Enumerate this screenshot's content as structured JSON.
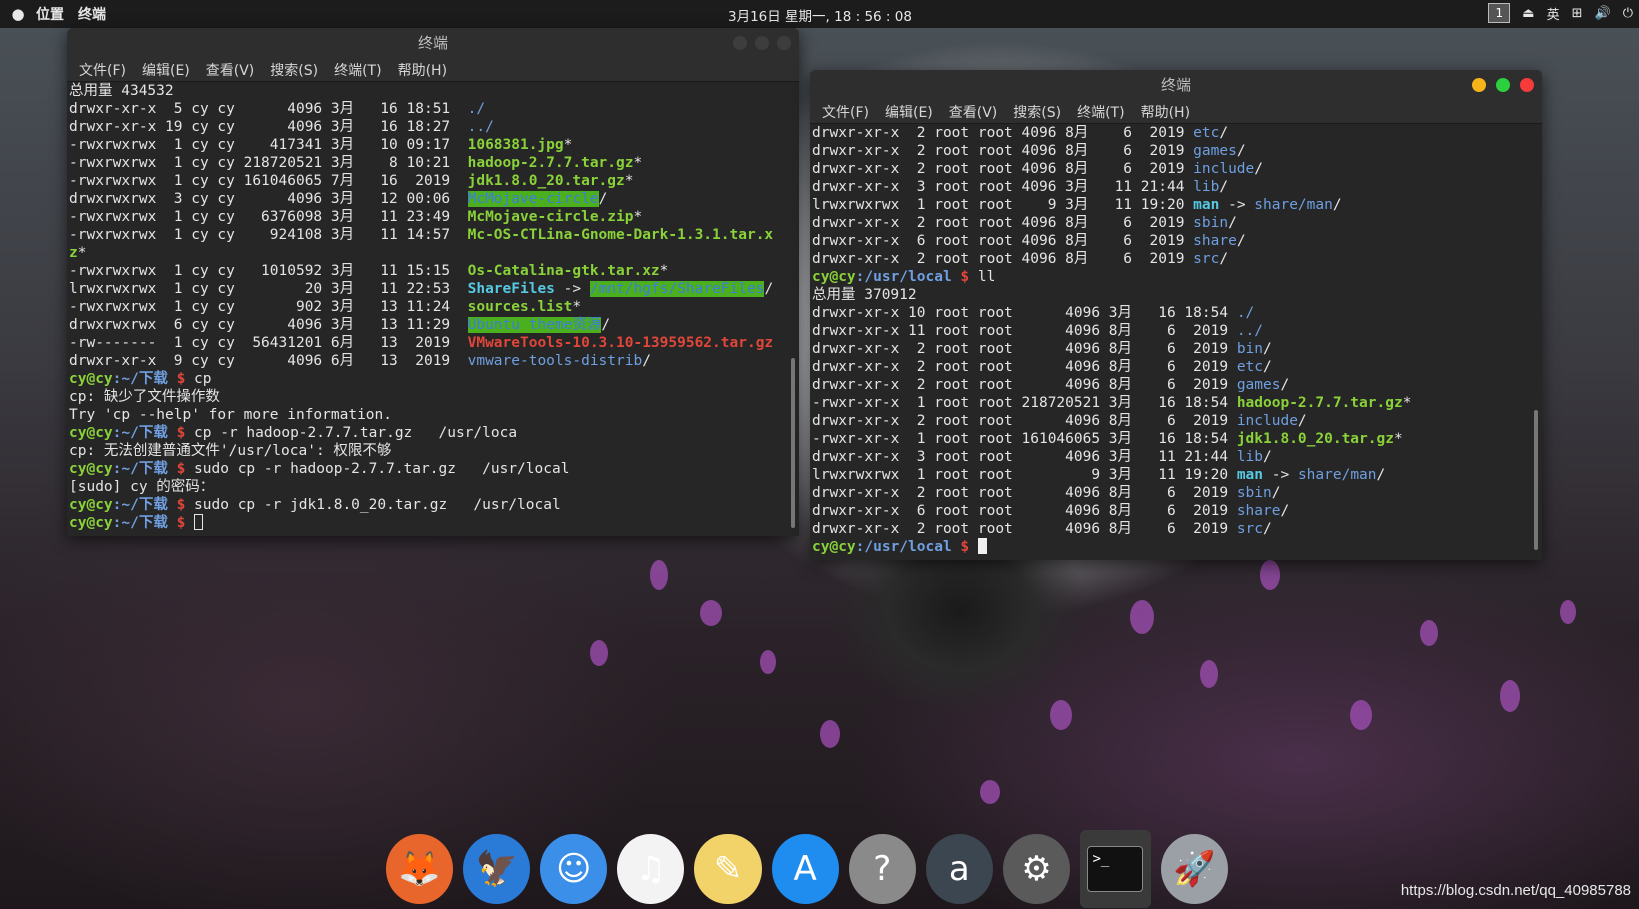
{
  "top_panel": {
    "menu": [
      "位置",
      "终端"
    ],
    "clock": "3月16日 星期一, 18 : 56 : 08",
    "workspace": "1",
    "input_method": "英"
  },
  "term_left": {
    "title": "终端",
    "menu": [
      "文件(F)",
      "编辑(E)",
      "查看(V)",
      "搜索(S)",
      "终端(T)",
      "帮助(H)"
    ],
    "lines": [
      [
        {
          "t": "总用量 434532"
        }
      ],
      [
        {
          "t": "drwxr-xr-x  5 cy cy      4096 3月   16 18:51  "
        },
        {
          "t": "./",
          "c": "c-blue"
        }
      ],
      [
        {
          "t": "drwxr-xr-x 19 cy cy      4096 3月   16 18:27  "
        },
        {
          "t": "../",
          "c": "c-blue"
        }
      ],
      [
        {
          "t": "-rwxrwxrwx  1 cy cy    417341 3月   10 09:17  "
        },
        {
          "t": "1068381.jpg",
          "c": "c-green"
        },
        {
          "t": "*"
        }
      ],
      [
        {
          "t": "-rwxrwxrwx  1 cy cy 218720521 3月    8 10:21  "
        },
        {
          "t": "hadoop-2.7.7.tar.gz",
          "c": "c-green"
        },
        {
          "t": "*"
        }
      ],
      [
        {
          "t": "-rwxrwxrwx  1 cy cy 161046065 7月   16  2019  "
        },
        {
          "t": "jdk1.8.0_20.tar.gz",
          "c": "c-green"
        },
        {
          "t": "*"
        }
      ],
      [
        {
          "t": "drwxrwxrwx  3 cy cy      4096 3月   12 00:06  "
        },
        {
          "t": "McMojave-circle",
          "c": "hl-dir"
        },
        {
          "t": "/"
        }
      ],
      [
        {
          "t": "-rwxrwxrwx  1 cy cy   6376098 3月   11 23:49  "
        },
        {
          "t": "McMojave-circle.zip",
          "c": "c-green"
        },
        {
          "t": "*"
        }
      ],
      [
        {
          "t": "-rwxrwxrwx  1 cy cy    924108 3月   11 14:57  "
        },
        {
          "t": "Mc-OS-CTLina-Gnome-Dark-1.3.1.tar.x",
          "c": "c-green"
        }
      ],
      [
        {
          "t": "z",
          "c": "c-green"
        },
        {
          "t": "*"
        }
      ],
      [
        {
          "t": "-rwxrwxrwx  1 cy cy   1010592 3月   11 15:15  "
        },
        {
          "t": "Os-Catalina-gtk.tar.xz",
          "c": "c-green"
        },
        {
          "t": "*"
        }
      ],
      [
        {
          "t": "lrwxrwxrwx  1 cy cy        20 3月   11 22:53  "
        },
        {
          "t": "ShareFiles",
          "c": "c-cyan"
        },
        {
          "t": " -> "
        },
        {
          "t": "/mnt/hgfs/ShareFiles",
          "c": "hl-dir"
        },
        {
          "t": "/"
        }
      ],
      [
        {
          "t": "-rwxrwxrwx  1 cy cy       902 3月   13 11:24  "
        },
        {
          "t": "sources.list",
          "c": "c-green"
        },
        {
          "t": "*"
        }
      ],
      [
        {
          "t": "drwxrwxrwx  6 cy cy      4096 3月   13 11:29  "
        },
        {
          "t": "Ubuntu theme资源",
          "c": "hl-dir"
        },
        {
          "t": "/"
        }
      ],
      [
        {
          "t": "-rw-------  1 cy cy  56431201 6月   13  2019  "
        },
        {
          "t": "VMwareTools-10.3.10-13959562.tar.gz",
          "c": "c-red"
        }
      ],
      [
        {
          "t": "drwxr-xr-x  9 cy cy      4096 6月   13  2019  "
        },
        {
          "t": "vmware-tools-distrib",
          "c": "c-blue"
        },
        {
          "t": "/"
        }
      ],
      [
        {
          "t": "cy@cy",
          "c": "c-prompt-user"
        },
        {
          "t": ":~/下载 ",
          "c": "c-prompt-path"
        },
        {
          "t": "$ ",
          "c": "c-prompt-sign"
        },
        {
          "t": "cp"
        }
      ],
      [
        {
          "t": "cp: 缺少了文件操作数"
        }
      ],
      [
        {
          "t": "Try 'cp --help' for more information."
        }
      ],
      [
        {
          "t": "cy@cy",
          "c": "c-prompt-user"
        },
        {
          "t": ":~/下载 ",
          "c": "c-prompt-path"
        },
        {
          "t": "$ ",
          "c": "c-prompt-sign"
        },
        {
          "t": "cp -r hadoop-2.7.7.tar.gz   /usr/loca"
        }
      ],
      [
        {
          "t": "cp: 无法创建普通文件'/usr/loca': 权限不够"
        }
      ],
      [
        {
          "t": "cy@cy",
          "c": "c-prompt-user"
        },
        {
          "t": ":~/下载 ",
          "c": "c-prompt-path"
        },
        {
          "t": "$ ",
          "c": "c-prompt-sign"
        },
        {
          "t": "sudo cp -r hadoop-2.7.7.tar.gz   /usr/local"
        }
      ],
      [
        {
          "t": "[sudo] cy 的密码："
        }
      ],
      [
        {
          "t": "cy@cy",
          "c": "c-prompt-user"
        },
        {
          "t": ":~/下载 ",
          "c": "c-prompt-path"
        },
        {
          "t": "$ ",
          "c": "c-prompt-sign"
        },
        {
          "t": "sudo cp -r jdk1.8.0_20.tar.gz   /usr/local"
        }
      ],
      [
        {
          "t": "cy@cy",
          "c": "c-prompt-user"
        },
        {
          "t": ":~/下载 ",
          "c": "c-prompt-path"
        },
        {
          "t": "$ ",
          "c": "c-prompt-sign"
        },
        {
          "cursor": "hollow"
        }
      ]
    ]
  },
  "term_right": {
    "title": "终端",
    "menu": [
      "文件(F)",
      "编辑(E)",
      "查看(V)",
      "搜索(S)",
      "终端(T)",
      "帮助(H)"
    ],
    "lines": [
      [
        {
          "t": "drwxr-xr-x  2 root root 4096 8月    6  2019 "
        },
        {
          "t": "etc",
          "c": "c-blue"
        },
        {
          "t": "/"
        }
      ],
      [
        {
          "t": "drwxr-xr-x  2 root root 4096 8月    6  2019 "
        },
        {
          "t": "games",
          "c": "c-blue"
        },
        {
          "t": "/"
        }
      ],
      [
        {
          "t": "drwxr-xr-x  2 root root 4096 8月    6  2019 "
        },
        {
          "t": "include",
          "c": "c-blue"
        },
        {
          "t": "/"
        }
      ],
      [
        {
          "t": "drwxr-xr-x  3 root root 4096 3月   11 21:44 "
        },
        {
          "t": "lib",
          "c": "c-blue"
        },
        {
          "t": "/"
        }
      ],
      [
        {
          "t": "lrwxrwxrwx  1 root root    9 3月   11 19:20 "
        },
        {
          "t": "man",
          "c": "c-cyan"
        },
        {
          "t": " -> "
        },
        {
          "t": "share/man",
          "c": "c-blue"
        },
        {
          "t": "/"
        }
      ],
      [
        {
          "t": "drwxr-xr-x  2 root root 4096 8月    6  2019 "
        },
        {
          "t": "sbin",
          "c": "c-blue"
        },
        {
          "t": "/"
        }
      ],
      [
        {
          "t": "drwxr-xr-x  6 root root 4096 8月    6  2019 "
        },
        {
          "t": "share",
          "c": "c-blue"
        },
        {
          "t": "/"
        }
      ],
      [
        {
          "t": "drwxr-xr-x  2 root root 4096 8月    6  2019 "
        },
        {
          "t": "src",
          "c": "c-blue"
        },
        {
          "t": "/"
        }
      ],
      [
        {
          "t": "cy@cy",
          "c": "c-prompt-user"
        },
        {
          "t": ":/usr/local ",
          "c": "c-prompt-path"
        },
        {
          "t": "$ ",
          "c": "c-prompt-sign"
        },
        {
          "t": "ll"
        }
      ],
      [
        {
          "t": "总用量 370912"
        }
      ],
      [
        {
          "t": "drwxr-xr-x 10 root root      4096 3月   16 18:54 "
        },
        {
          "t": "./",
          "c": "c-blue"
        }
      ],
      [
        {
          "t": "drwxr-xr-x 11 root root      4096 8月    6  2019 "
        },
        {
          "t": "../",
          "c": "c-blue"
        }
      ],
      [
        {
          "t": "drwxr-xr-x  2 root root      4096 8月    6  2019 "
        },
        {
          "t": "bin",
          "c": "c-blue"
        },
        {
          "t": "/"
        }
      ],
      [
        {
          "t": "drwxr-xr-x  2 root root      4096 8月    6  2019 "
        },
        {
          "t": "etc",
          "c": "c-blue"
        },
        {
          "t": "/"
        }
      ],
      [
        {
          "t": "drwxr-xr-x  2 root root      4096 8月    6  2019 "
        },
        {
          "t": "games",
          "c": "c-blue"
        },
        {
          "t": "/"
        }
      ],
      [
        {
          "t": "-rwxr-xr-x  1 root root 218720521 3月   16 18:54 "
        },
        {
          "t": "hadoop-2.7.7.tar.gz",
          "c": "c-green"
        },
        {
          "t": "*"
        }
      ],
      [
        {
          "t": "drwxr-xr-x  2 root root      4096 8月    6  2019 "
        },
        {
          "t": "include",
          "c": "c-blue"
        },
        {
          "t": "/"
        }
      ],
      [
        {
          "t": "-rwxr-xr-x  1 root root 161046065 3月   16 18:54 "
        },
        {
          "t": "jdk1.8.0_20.tar.gz",
          "c": "c-green"
        },
        {
          "t": "*"
        }
      ],
      [
        {
          "t": "drwxr-xr-x  3 root root      4096 3月   11 21:44 "
        },
        {
          "t": "lib",
          "c": "c-blue"
        },
        {
          "t": "/"
        }
      ],
      [
        {
          "t": "lrwxrwxrwx  1 root root         9 3月   11 19:20 "
        },
        {
          "t": "man",
          "c": "c-cyan"
        },
        {
          "t": " -> "
        },
        {
          "t": "share/man",
          "c": "c-blue"
        },
        {
          "t": "/"
        }
      ],
      [
        {
          "t": "drwxr-xr-x  2 root root      4096 8月    6  2019 "
        },
        {
          "t": "sbin",
          "c": "c-blue"
        },
        {
          "t": "/"
        }
      ],
      [
        {
          "t": "drwxr-xr-x  6 root root      4096 8月    6  2019 "
        },
        {
          "t": "share",
          "c": "c-blue"
        },
        {
          "t": "/"
        }
      ],
      [
        {
          "t": "drwxr-xr-x  2 root root      4096 8月    6  2019 "
        },
        {
          "t": "src",
          "c": "c-blue"
        },
        {
          "t": "/"
        }
      ],
      [
        {
          "t": "cy@cy",
          "c": "c-prompt-user"
        },
        {
          "t": ":/usr/local ",
          "c": "c-prompt-path"
        },
        {
          "t": "$ ",
          "c": "c-prompt-sign"
        },
        {
          "cursor": "solid"
        }
      ]
    ]
  },
  "dock": [
    {
      "name": "firefox-icon",
      "glyph": "🦊",
      "color": "#e8662c"
    },
    {
      "name": "thunderbird-icon",
      "glyph": "🦅",
      "color": "#2a7ad8"
    },
    {
      "name": "finder-icon",
      "glyph": "☺",
      "color": "#3b8fe8"
    },
    {
      "name": "music-icon",
      "glyph": "♫",
      "color": "#f3f3f3"
    },
    {
      "name": "text-editor-icon",
      "glyph": "✎",
      "color": "#f2d36a"
    },
    {
      "name": "app-store-icon",
      "glyph": "A",
      "color": "#1f8cf0"
    },
    {
      "name": "help-icon",
      "glyph": "?",
      "color": "#8a8a8a"
    },
    {
      "name": "amazon-icon",
      "glyph": "a",
      "color": "#3c4650"
    },
    {
      "name": "settings-icon",
      "glyph": "⚙",
      "color": "#5a5a5a"
    },
    {
      "name": "terminal-icon",
      "glyph": ">_",
      "color": "#111111",
      "active": true
    },
    {
      "name": "launchpad-icon",
      "glyph": "🚀",
      "color": "#9aa0a6"
    }
  ],
  "watermark": "https://blog.csdn.net/qq_40985788"
}
